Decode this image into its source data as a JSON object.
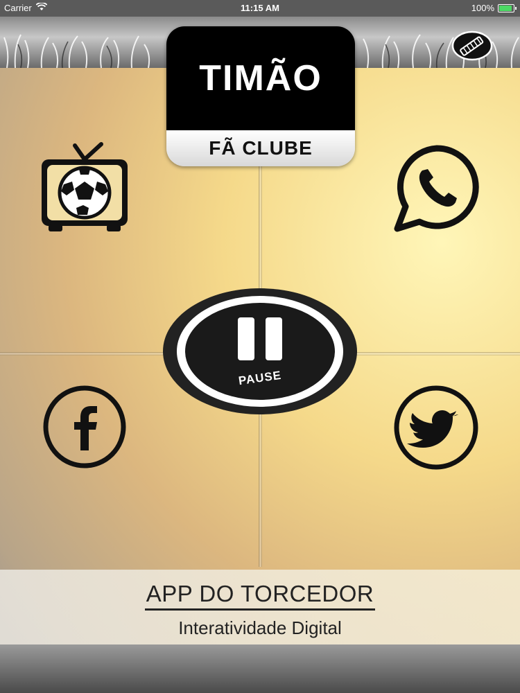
{
  "status_bar": {
    "carrier": "Carrier",
    "time": "11:15 AM",
    "battery": "100%"
  },
  "logo": {
    "title": "TIMÃO",
    "subtitle": "FÃ CLUBE"
  },
  "player": {
    "pause_label": "PAUSE"
  },
  "footer": {
    "title": "APP DO TORCEDOR",
    "subtitle": "Interatividade Digital"
  },
  "colors": {
    "accent": "#000000",
    "background": "#f5d98a",
    "battery": "#4cd964"
  },
  "icons": [
    "wifi-icon",
    "battery-icon",
    "edit-icon",
    "tv-football-icon",
    "whatsapp-icon",
    "facebook-icon",
    "twitter-icon",
    "pause-icon"
  ]
}
